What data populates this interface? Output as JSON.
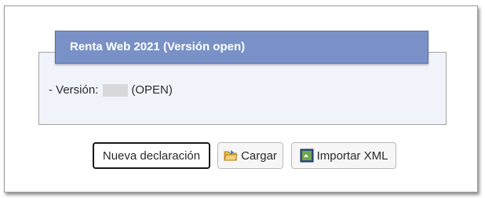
{
  "panel": {
    "title": "Renta Web 2021 (Versión open)",
    "version_prefix": "- Versión:",
    "version_suffix": "(OPEN)"
  },
  "buttons": {
    "new_declaration": "Nueva declaración",
    "load": "Cargar",
    "import_xml": "Importar XML"
  },
  "icons": {
    "load": "folder-open-icon",
    "import_xml": "import-xml-icon"
  },
  "colors": {
    "panel_header": "#7991c7",
    "panel_body": "#f1f3fa"
  }
}
